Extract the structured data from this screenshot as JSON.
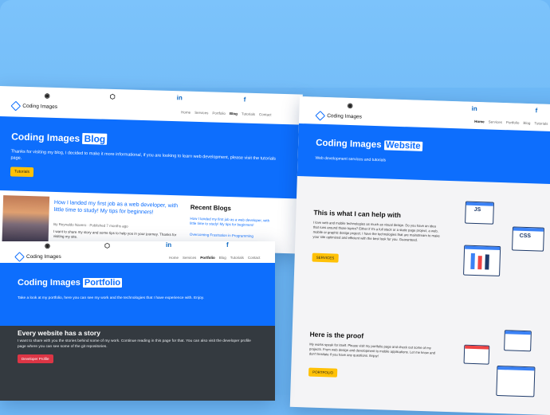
{
  "brand": "Coding Images",
  "blog": {
    "nav": [
      "Home",
      "Services",
      "Portfolio",
      "Blog",
      "Tutorials",
      "Contact"
    ],
    "active": "Blog",
    "hero_title": "Coding Images",
    "hero_highlight": "Blog",
    "hero_text": "Thanks for visiting my blog, I decided to make it more informational, if you are looking to learn web development, please visit the tutorials page.",
    "hero_button": "Tutorials",
    "post_title": "How I landed my first job as a web developer, with little time to study! My tips for beginners!",
    "post_meta": "By Reynaldo Navero · Published 7 months ago",
    "post_text": "I want to share my story and some tips to help you in your journey. Thanks for visiting my site.",
    "recent_title": "Recent Blogs",
    "recent_items": [
      "How I landed my first job as a web developer, with little time to study! My tips for beginners!",
      "Overcoming Frustration in Programming"
    ]
  },
  "portfolio": {
    "nav": [
      "Home",
      "Services",
      "Portfolio",
      "Blog",
      "Tutorials",
      "Contact"
    ],
    "active": "Portfolio",
    "hero_title": "Coding Images",
    "hero_highlight": "Portfolio",
    "hero_text": "Take a look at my portfolio, here you can see my work and the technologies that I have experience with. Enjoy.",
    "story_title": "Every website has a story",
    "story_text": "I want to share with you the stories behind some of my work. Continue reading in this page for that. You can also visit the developer profile page where you can see some of the git repositories.",
    "story_button": "Developer Profile"
  },
  "website": {
    "nav": [
      "Home",
      "Services",
      "Portfolio",
      "Blog",
      "Tutorials"
    ],
    "active": "Home",
    "hero_title": "Coding Images",
    "hero_highlight": "Website",
    "hero_text": "Web development services and tutorials",
    "help_title": "This is what I can help with",
    "help_text": "I love web and mobile technologies as much as visual design. Do you have an idea that runs around those topics? Either if it's a full stack or a static page project, a web, mobile or graphic design project, I have the technologies that are mainstream to make your site optimized and efficient with the best look for you. Guaranteed.",
    "help_button": "SERVICES",
    "proof_title": "Here is the proof",
    "proof_text": "My works speak for itself. Please visit my portfolio page and check out some of my projects. From web design and development to mobile applications. Let me know and don't hesitate if you have any questions. Enjoy!",
    "proof_button": "PORTFOLIO",
    "js_label": "JS",
    "css_label": "CSS"
  },
  "icons": [
    "github-icon",
    "codepen-icon",
    "linkedin-icon",
    "facebook-icon"
  ]
}
